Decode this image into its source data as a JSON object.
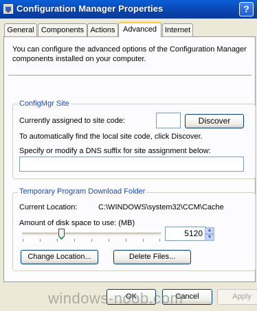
{
  "window": {
    "title": "Configuration Manager Properties",
    "help_label": "?"
  },
  "tabs": [
    {
      "label": "General"
    },
    {
      "label": "Components"
    },
    {
      "label": "Actions"
    },
    {
      "label": "Advanced"
    },
    {
      "label": "Internet"
    }
  ],
  "active_tab": "Advanced",
  "intro": {
    "line1": "You can configure the advanced options of the Configuration Manager",
    "line2": "components installed on your computer."
  },
  "configmgr_site": {
    "title": "ConfigMgr Site",
    "assigned_label": "Currently assigned to site code:",
    "site_code_value": "",
    "discover_label": "Discover",
    "auto_find_text": "To automatically find the local site code, click Discover.",
    "dns_label": "Specify or modify a DNS suffix for site assignment below:",
    "dns_value": ""
  },
  "download_folder": {
    "title": "Temporary Program Download Folder",
    "location_label": "Current Location:",
    "location_value": "C:\\WINDOWS\\system32\\CCM\\Cache",
    "disk_space_label": "Amount of disk space to use: (MB)",
    "disk_space_value": "5120",
    "change_location_label": "Change Location...",
    "delete_files_label": "Delete Files..."
  },
  "footer": {
    "ok_label": "OK",
    "cancel_label": "Cancel",
    "apply_label": "Apply"
  },
  "watermark": "windows-noob.com",
  "colors": {
    "title_bar": "#0a4fc2",
    "group_title": "#1f46b4",
    "active_tab_accent": "#ffc83c"
  }
}
